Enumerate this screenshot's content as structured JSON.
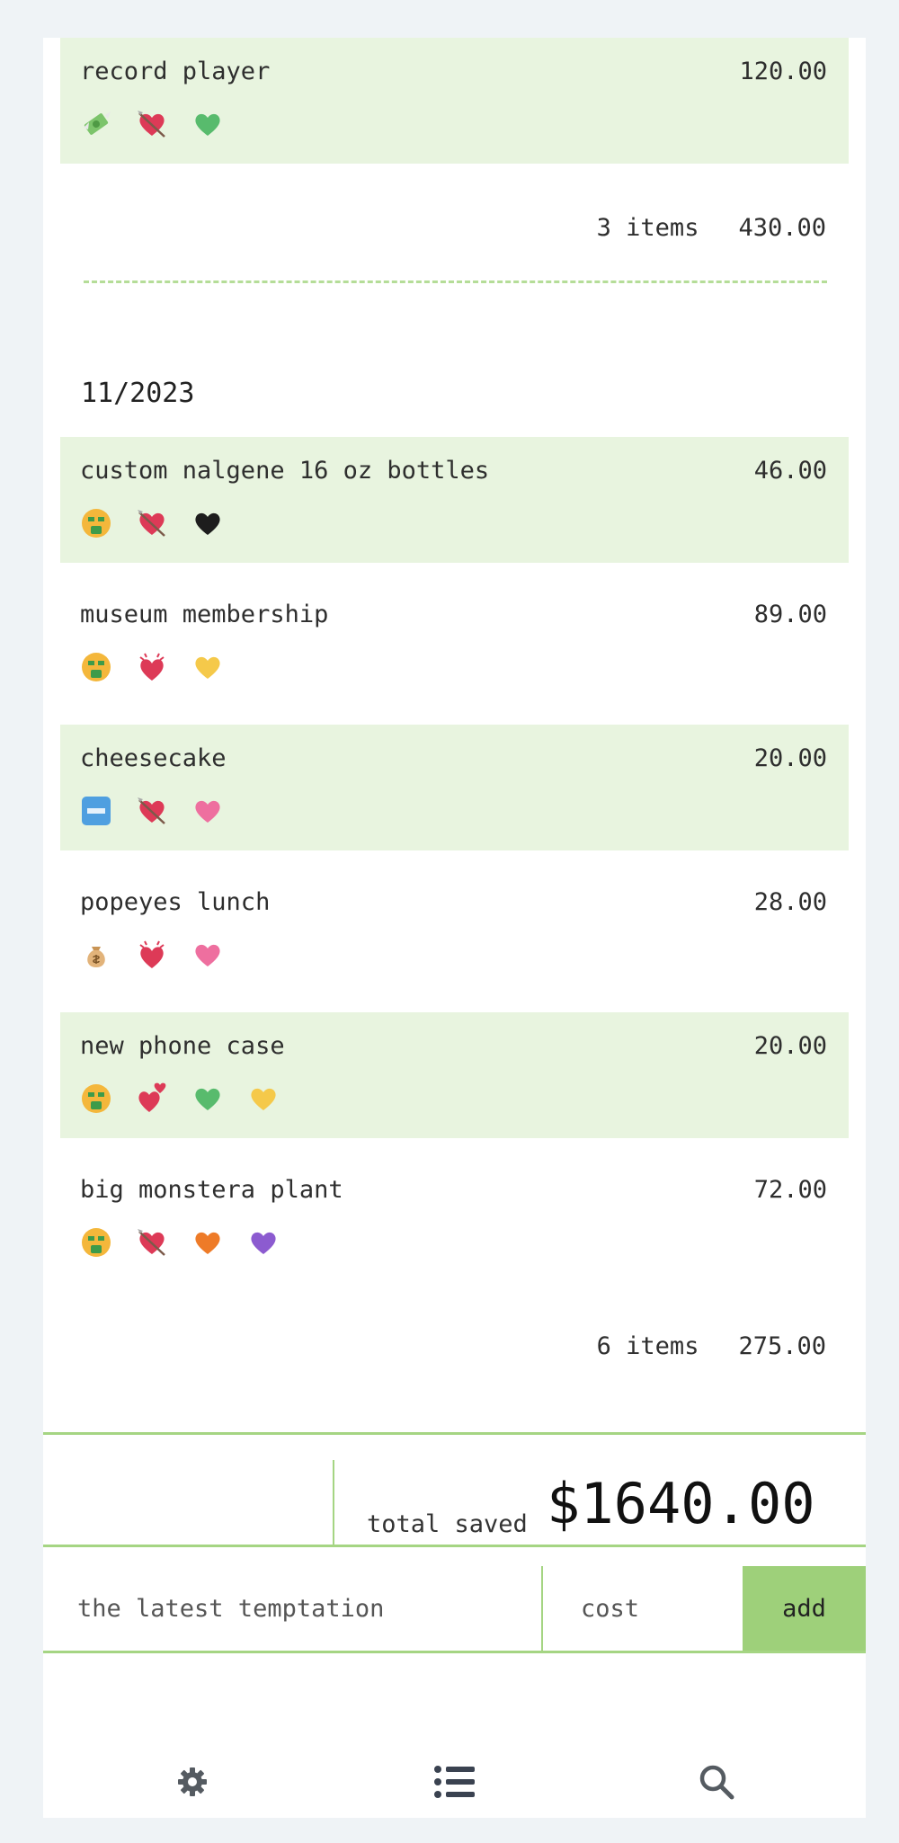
{
  "colors": {
    "accent": "#9ed07a",
    "accent_line": "#a5d583",
    "row_alt": "#e8f4df",
    "background": "#eff3f6"
  },
  "groups": [
    {
      "month": "",
      "items": [
        {
          "name": "record player",
          "price": "120.00",
          "alt": true,
          "emojis": [
            "money-wings-icon",
            "heart-arrow-icon",
            "green-heart-icon"
          ]
        }
      ],
      "summary": {
        "count": "3 items",
        "total": "430.00"
      }
    },
    {
      "month": "11/2023",
      "items": [
        {
          "name": "custom nalgene 16 oz bottles",
          "price": "46.00",
          "alt": true,
          "emojis": [
            "money-mouth-face-icon",
            "heart-arrow-icon",
            "black-heart-icon"
          ]
        },
        {
          "name": "museum membership",
          "price": "89.00",
          "alt": false,
          "emojis": [
            "money-mouth-face-icon",
            "beating-heart-icon",
            "yellow-heart-icon"
          ]
        },
        {
          "name": "cheesecake",
          "price": "20.00",
          "alt": true,
          "emojis": [
            "free-button-icon",
            "heart-arrow-icon",
            "pink-heart-icon"
          ]
        },
        {
          "name": "popeyes lunch",
          "price": "28.00",
          "alt": false,
          "emojis": [
            "money-bag-icon",
            "beating-heart-icon",
            "pink-heart-icon"
          ]
        },
        {
          "name": "new phone case",
          "price": "20.00",
          "alt": true,
          "emojis": [
            "money-mouth-face-icon",
            "heart-exclamation-icon",
            "green-heart-icon",
            "yellow-heart-icon"
          ]
        },
        {
          "name": "big monstera plant",
          "price": "72.00",
          "alt": false,
          "emojis": [
            "money-mouth-face-icon",
            "heart-arrow-icon",
            "orange-heart-icon",
            "purple-heart-icon"
          ]
        }
      ],
      "summary": {
        "count": "6 items",
        "total": "275.00"
      }
    }
  ],
  "total": {
    "label": "total saved",
    "amount": "$1640.00"
  },
  "entry": {
    "name_placeholder": "the latest temptation",
    "cost_placeholder": "cost",
    "add_label": "add"
  },
  "nav": [
    "gear-icon",
    "list-icon",
    "search-icon"
  ]
}
